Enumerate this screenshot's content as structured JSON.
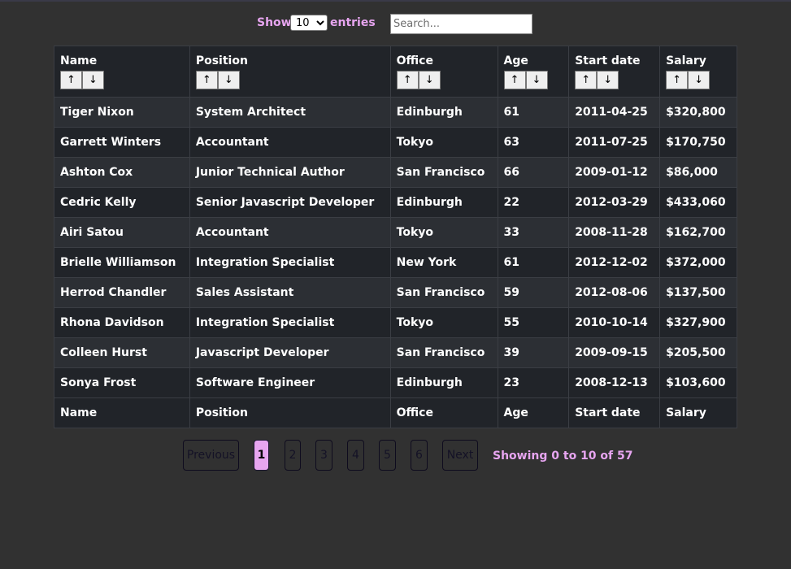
{
  "controls": {
    "show_label": "Show",
    "entries_value": "10",
    "entries_label": "entries",
    "search_placeholder": "Search..."
  },
  "columns": [
    "Name",
    "Position",
    "Office",
    "Age",
    "Start date",
    "Salary"
  ],
  "sort_icons": {
    "asc": "arrow-up-icon",
    "desc": "arrow-down-icon"
  },
  "rows": [
    [
      "Tiger Nixon",
      "System Architect",
      "Edinburgh",
      "61",
      "2011-04-25",
      "$320,800"
    ],
    [
      "Garrett Winters",
      "Accountant",
      "Tokyo",
      "63",
      "2011-07-25",
      "$170,750"
    ],
    [
      "Ashton Cox",
      "Junior Technical Author",
      "San Francisco",
      "66",
      "2009-01-12",
      "$86,000"
    ],
    [
      "Cedric Kelly",
      "Senior Javascript Developer",
      "Edinburgh",
      "22",
      "2012-03-29",
      "$433,060"
    ],
    [
      "Airi Satou",
      "Accountant",
      "Tokyo",
      "33",
      "2008-11-28",
      "$162,700"
    ],
    [
      "Brielle Williamson",
      "Integration Specialist",
      "New York",
      "61",
      "2012-12-02",
      "$372,000"
    ],
    [
      "Herrod Chandler",
      "Sales Assistant",
      "San Francisco",
      "59",
      "2012-08-06",
      "$137,500"
    ],
    [
      "Rhona Davidson",
      "Integration Specialist",
      "Tokyo",
      "55",
      "2010-10-14",
      "$327,900"
    ],
    [
      "Colleen Hurst",
      "Javascript Developer",
      "San Francisco",
      "39",
      "2009-09-15",
      "$205,500"
    ],
    [
      "Sonya Frost",
      "Software Engineer",
      "Edinburgh",
      "23",
      "2008-12-13",
      "$103,600"
    ]
  ],
  "pagination": {
    "previous_label": "Previous",
    "pages": [
      "1",
      "2",
      "3",
      "4",
      "5",
      "6"
    ],
    "active_page": "1",
    "next_label": "Next",
    "info": "Showing 0 to 10 of 57"
  },
  "colors": {
    "background": "#313131",
    "accent": "#e7a5f0",
    "table_dark": "#212429",
    "table_light": "#2c2f34"
  }
}
